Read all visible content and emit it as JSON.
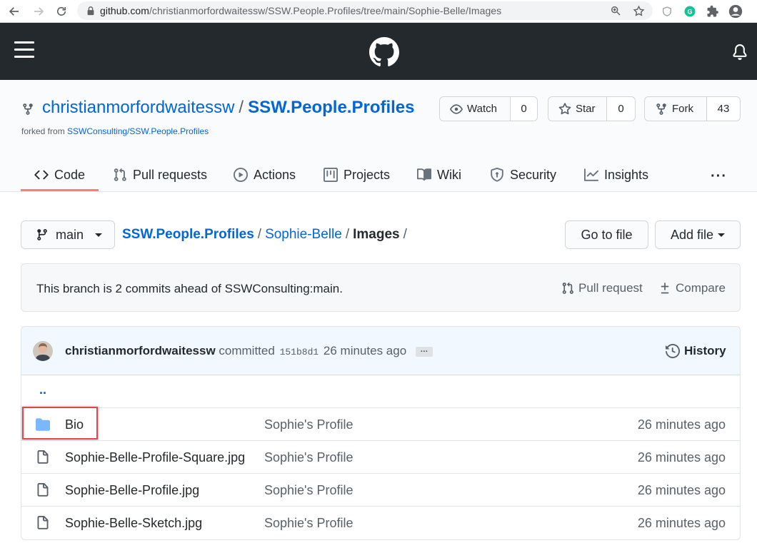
{
  "browser": {
    "url_host": "github.com",
    "url_path": "/christianmorfordwaitessw/SSW.People.Profiles/tree/main/Sophie-Belle/Images",
    "icons": [
      "back-arrow-icon",
      "forward-arrow-icon",
      "reload-icon",
      "lock-icon",
      "zoom-icon",
      "star-icon",
      "extension-shield-icon",
      "grammarly-icon",
      "puzzle-icon",
      "profile-icon"
    ]
  },
  "repo": {
    "owner": "christianmorfordwaitessw",
    "separator": "/",
    "name": "SSW.People.Profiles",
    "forked_prefix": "forked from",
    "forked_from": "SSWConsulting/SSW.People.Profiles",
    "actions": [
      {
        "label": "Watch",
        "count": "0",
        "icon": "eye-icon"
      },
      {
        "label": "Star",
        "count": "0",
        "icon": "star-icon"
      },
      {
        "label": "Fork",
        "count": "43",
        "icon": "fork-icon"
      }
    ]
  },
  "tabs": [
    {
      "label": "Code",
      "icon": "code-icon",
      "active": true
    },
    {
      "label": "Pull requests",
      "icon": "pull-request-icon"
    },
    {
      "label": "Actions",
      "icon": "play-icon"
    },
    {
      "label": "Projects",
      "icon": "project-icon"
    },
    {
      "label": "Wiki",
      "icon": "book-icon"
    },
    {
      "label": "Security",
      "icon": "shield-icon"
    },
    {
      "label": "Insights",
      "icon": "graph-icon"
    }
  ],
  "more": "···",
  "file_nav": {
    "branch": "main",
    "path_root": "SSW.People.Profiles",
    "path_mid": "Sophie-Belle",
    "path_current": "Images",
    "sep": "/",
    "go_to_file": "Go to file",
    "add_file": "Add file"
  },
  "branch_info": {
    "message": "This branch is 2 commits ahead of SSWConsulting:main.",
    "pull_request": "Pull request",
    "compare": "Compare"
  },
  "commit": {
    "author": "christianmorfordwaitessw",
    "verb": "committed",
    "sha": "151b8d1",
    "time": "26 minutes ago",
    "ellipsis": "…",
    "history": "History"
  },
  "parent_dir": "..",
  "files": [
    {
      "name": "Bio",
      "type": "folder",
      "message": "Sophie's Profile",
      "age": "26 minutes ago"
    },
    {
      "name": "Sophie-Belle-Profile-Square.jpg",
      "type": "file",
      "message": "Sophie's Profile",
      "age": "26 minutes ago"
    },
    {
      "name": "Sophie-Belle-Profile.jpg",
      "type": "file",
      "message": "Sophie's Profile",
      "age": "26 minutes ago"
    },
    {
      "name": "Sophie-Belle-Sketch.jpg",
      "type": "file",
      "message": "Sophie's Profile",
      "age": "26 minutes ago"
    }
  ],
  "colors": {
    "link": "#0366d6",
    "header_bg": "#24292e",
    "tab_underline": "#f9826c",
    "folder": "#79b8ff",
    "highlight": "#e0474c"
  }
}
